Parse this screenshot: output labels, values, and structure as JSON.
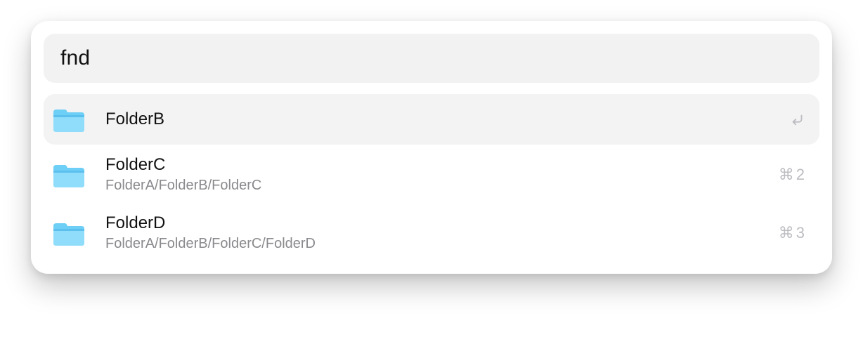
{
  "search": {
    "value": "fnd",
    "placeholder": ""
  },
  "results": [
    {
      "title": "FolderB",
      "path": "",
      "shortcut_cmd": false,
      "shortcut_key": "",
      "shortcut_enter": true,
      "selected": true
    },
    {
      "title": "FolderC",
      "path": "FolderA/FolderB/FolderC",
      "shortcut_cmd": true,
      "shortcut_key": "2",
      "shortcut_enter": false,
      "selected": false
    },
    {
      "title": "FolderD",
      "path": "FolderA/FolderB/FolderC/FolderD",
      "shortcut_cmd": true,
      "shortcut_key": "3",
      "shortcut_enter": false,
      "selected": false
    }
  ]
}
